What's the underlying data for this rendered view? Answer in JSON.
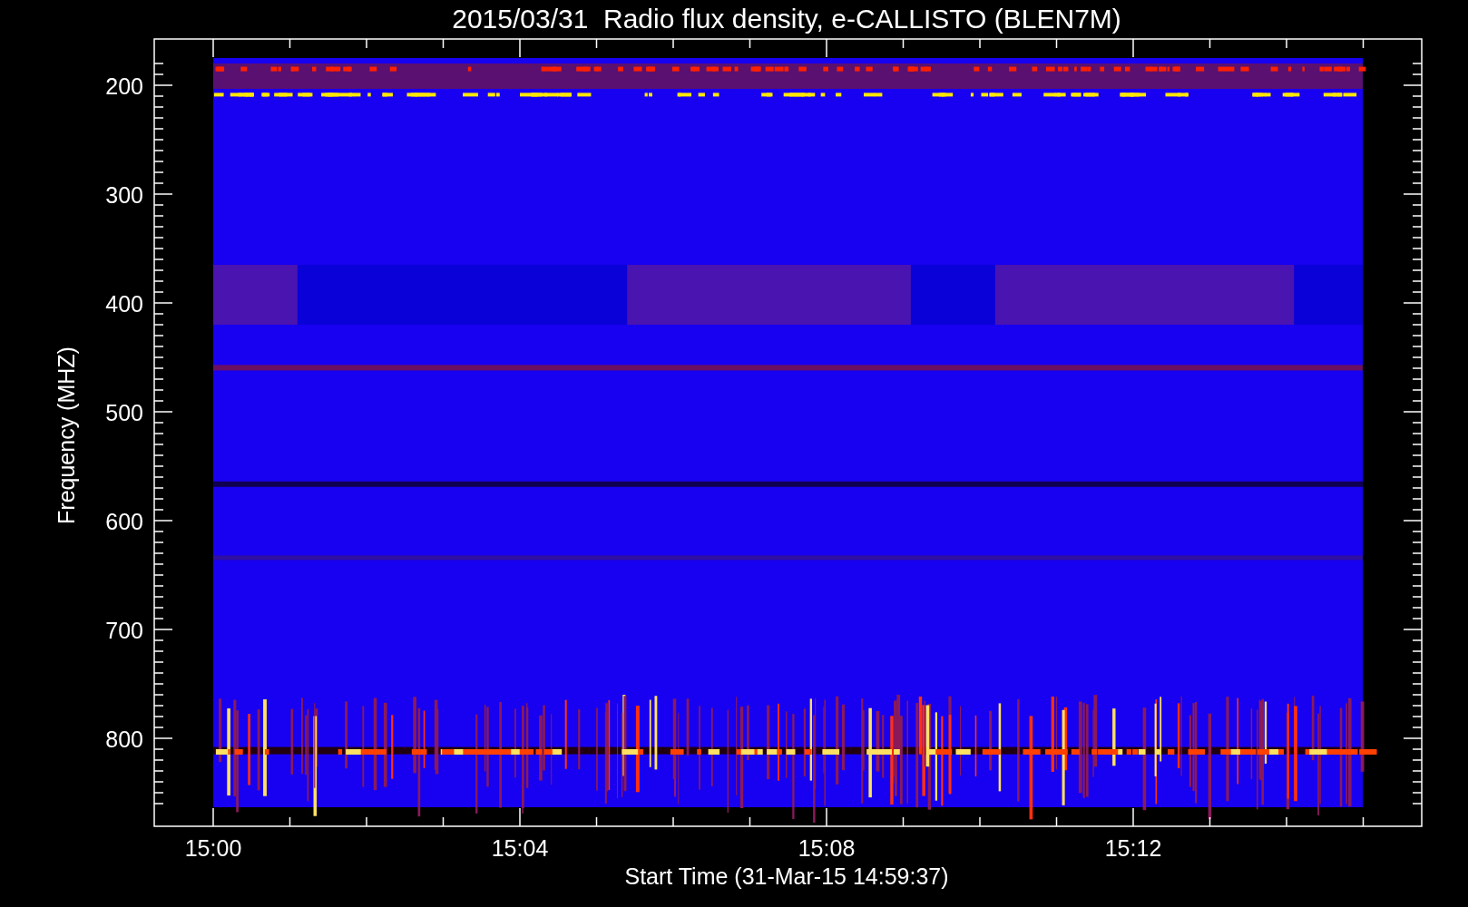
{
  "title": "2015/03/31  Radio flux density, e-CALLISTO (BLEN7M)",
  "y_axis": {
    "label": "Frequency (MHZ)",
    "ticks": [
      "200",
      "300",
      "400",
      "500",
      "600",
      "700",
      "800"
    ]
  },
  "x_axis": {
    "label": "Start Time (31-Mar-15 14:59:37)",
    "ticks": [
      "15:00",
      "15:04",
      "15:08",
      "15:12"
    ]
  }
}
